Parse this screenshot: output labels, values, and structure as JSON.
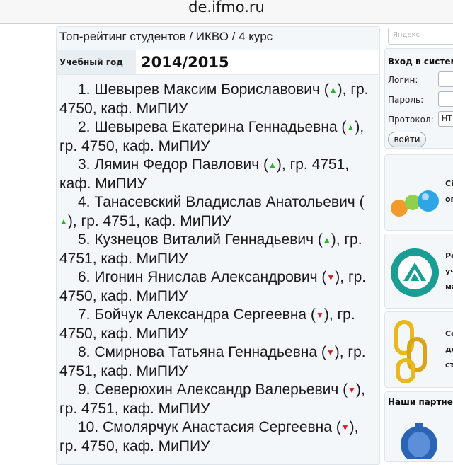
{
  "browser": {
    "url": "de.ifmo.ru"
  },
  "main": {
    "breadcrumb": "Топ-рейтинг студентов / ИКВО / 4 курс",
    "year_label": "Учебный год",
    "year_value": "2014/2015",
    "entries": [
      {
        "pre": "1. Шевырев Максим Бориславович (",
        "trend": "up",
        "post": "), гр. 4750, каф. МиПИУ"
      },
      {
        "pre": "2. Шевырева Екатерина Геннадьевна (",
        "trend": "up",
        "post": "), гр. 4750, каф. МиПИУ"
      },
      {
        "pre": "3. Лямин Федор Павлович (",
        "trend": "up",
        "post": "), гр. 4751, каф. МиПИУ"
      },
      {
        "pre": "4. Танасевский Владислав Анатольевич (",
        "trend": "up",
        "post": "), гр. 4751, каф. МиПИУ"
      },
      {
        "pre": "5. Кузнецов Виталий Геннадьевич (",
        "trend": "up",
        "post": "), гр. 4751, каф. МиПИУ"
      },
      {
        "pre": "6. Игонин Янислав Александрович (",
        "trend": "down",
        "post": "), гр. 4750, каф. МиПИУ"
      },
      {
        "pre": "7. Бойчук Александра Сергеевна (",
        "trend": "down",
        "post": "), гр. 4750, каф. МиПИУ"
      },
      {
        "pre": "8. Смирнова Татьяна Геннадьевна (",
        "trend": "down",
        "post": "), гр. 4751, каф. МиПИУ"
      },
      {
        "pre": "9. Северюхин Александр Валерьевич (",
        "trend": "down",
        "post": "), гр. 4751, каф. МиПИУ"
      },
      {
        "pre": "10. Смолярчук Анастасия Сергеевна (",
        "trend": "down",
        "post": "), гр. 4750, каф. МиПИУ"
      }
    ],
    "arrow_up_glyph": "▲",
    "arrow_down_glyph": "▼"
  },
  "sidebar": {
    "search_placeholder": "Яндекс",
    "login": {
      "title": "Вход в систем",
      "login_label": "Логин:",
      "password_label": "Пароль:",
      "protocol_label": "Протокол:",
      "protocol_value": "HT",
      "submit": "войти"
    },
    "card1_text": [
      "Сі",
      "ог"
    ],
    "card2_text": [
      "Ре",
      "уч",
      "ма"
    ],
    "card3_text": [
      "Сс",
      "де",
      "ст"
    ],
    "partners_title": "Наши партне"
  },
  "colors": {
    "up": "#2fae2f",
    "down": "#cc1f1f",
    "panel": "#f3f7fa"
  }
}
